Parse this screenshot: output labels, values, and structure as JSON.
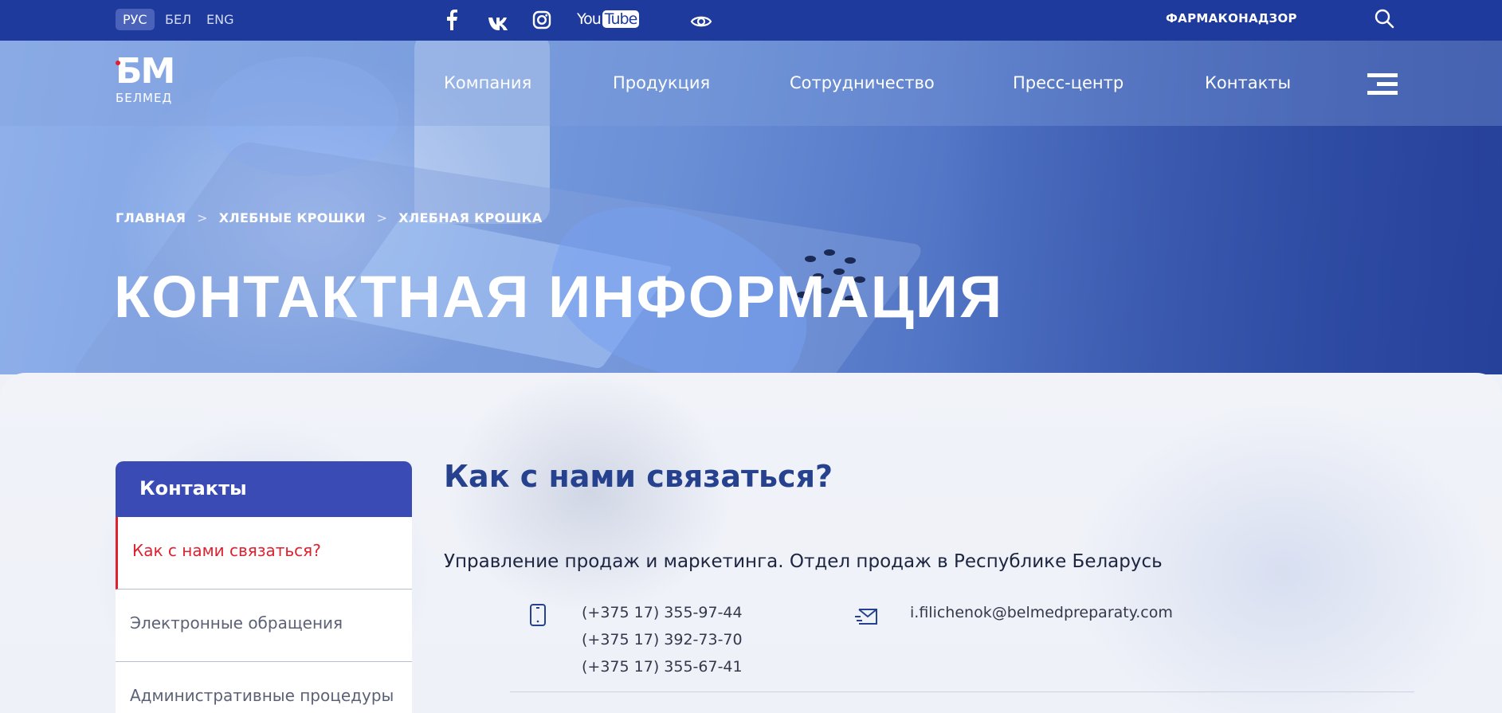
{
  "languages": [
    {
      "label": "РУС",
      "active": true
    },
    {
      "label": "БЕЛ",
      "active": false
    },
    {
      "label": "ENG",
      "active": false
    }
  ],
  "social": {
    "icons": [
      "facebook-icon",
      "vk-icon",
      "instagram-icon",
      "youtube-icon",
      "eye-icon"
    ],
    "youtube_you": "You",
    "youtube_tube": "Tube"
  },
  "topbar": {
    "farma_label": "ФАРМАКОНАДЗОР",
    "search_icon": "search-icon"
  },
  "logo": {
    "mark": "БМ",
    "name": "БЕЛМЕД"
  },
  "nav": {
    "items": [
      "Компания",
      "Продукция",
      "Сотрудничество",
      "Пресс-центр",
      "Контакты"
    ],
    "menu_icon": "hamburger-icon"
  },
  "breadcrumbs": {
    "items": [
      "ГЛАВНАЯ",
      "ХЛЕБНЫЕ КРОШКИ",
      "ХЛЕБНАЯ КРОШКА"
    ],
    "separator": ">"
  },
  "page_title": "КОНТАКТНАЯ ИНФОРМАЦИЯ",
  "sidebar": {
    "heading": "Контакты",
    "items": [
      {
        "label": "Как с нами связаться?",
        "active": true
      },
      {
        "label": "Электронные обращения",
        "active": false
      },
      {
        "label": "Административные процедуры",
        "active": false
      }
    ]
  },
  "main": {
    "heading": "Как с нами связаться?",
    "department": "Управление продаж и маркетинга. Отдел продаж в Республике Беларусь",
    "phones": [
      "(+375 17) 355-97-44",
      "(+375 17) 392-73-70",
      "(+375 17) 355-67-41"
    ],
    "email": "i.filichenok@belmedpreparaty.com"
  },
  "colors": {
    "topbar": "#1e3a9c",
    "sidebar_head": "#3a4bb5",
    "active_red": "#e0202f",
    "heading_blue": "#26418e"
  }
}
